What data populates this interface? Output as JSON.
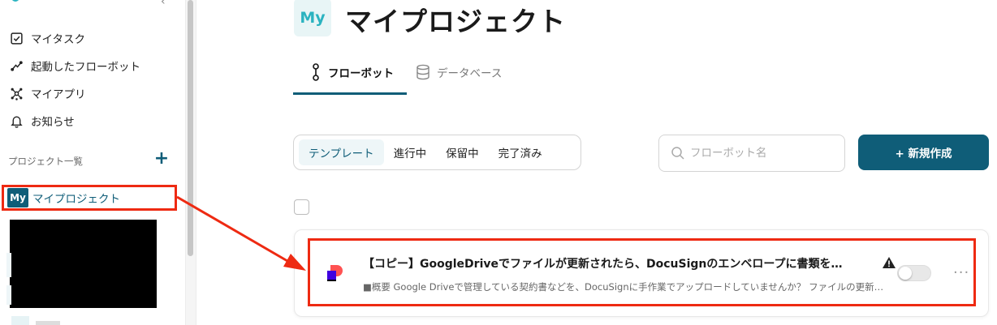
{
  "sidebar": {
    "nav": [
      {
        "label": "マイタスク",
        "icon": "checkbox-icon"
      },
      {
        "label": "起動したフローボット",
        "icon": "flow-icon"
      },
      {
        "label": "マイアプリ",
        "icon": "apps-icon"
      },
      {
        "label": "お知らせ",
        "icon": "bell-icon"
      }
    ],
    "projects_label": "プロジェクト一覧",
    "add_label": "+",
    "project": {
      "badge": "My",
      "label": "マイプロジェクト"
    }
  },
  "page": {
    "badge": "My",
    "title": "マイプロジェクト"
  },
  "tabs": [
    {
      "label": "フローボット",
      "active": true
    },
    {
      "label": "データベース",
      "active": false
    }
  ],
  "filters": [
    {
      "label": "テンプレート",
      "active": true
    },
    {
      "label": "進行中",
      "active": false
    },
    {
      "label": "保留中",
      "active": false
    },
    {
      "label": "完了済み",
      "active": false
    }
  ],
  "search": {
    "placeholder": "フローボット名"
  },
  "new_button": {
    "label": "+ 新規作成"
  },
  "flows": [
    {
      "title": "【コピー】GoogleDriveでファイルが更新されたら、DocuSignのエンベロープに書類を…",
      "description": "■概要 Google Driveで管理している契約書などを、DocuSignに手作業でアップロードしていませんか？ ファイルの更新…",
      "enabled": false,
      "warning": true
    }
  ],
  "more_label": "···",
  "colors": {
    "accent": "#0f5d78",
    "highlight": "#ee2a12",
    "badge": "#2bb3c0"
  }
}
